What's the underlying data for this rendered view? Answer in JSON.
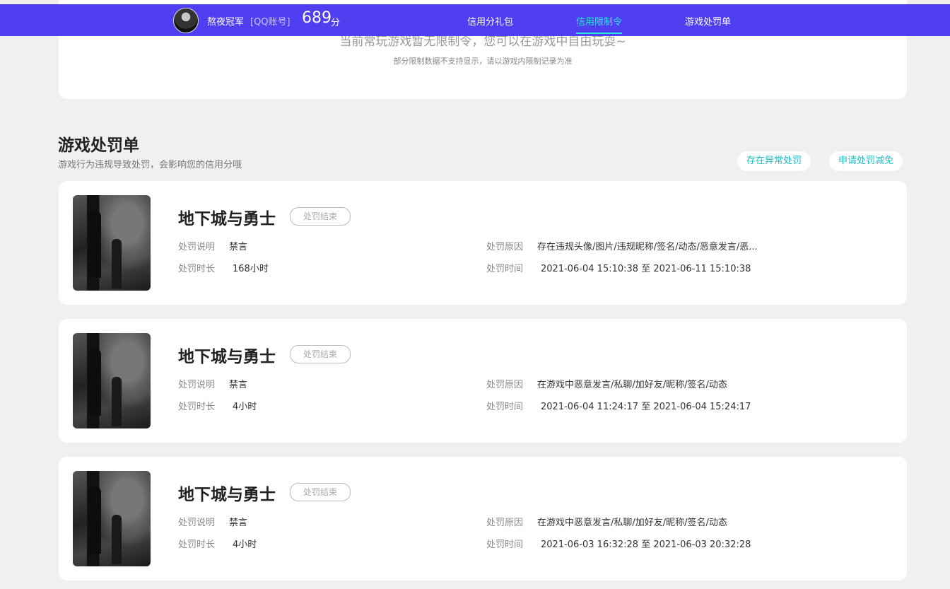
{
  "header": {
    "nickname": "熬夜冠军",
    "account_type": "[QQ账号]",
    "score": "689",
    "score_unit": "分",
    "nav": {
      "gift": "信用分礼包",
      "limit": "信用限制令",
      "punish": "游戏处罚单"
    },
    "active_tab": "信用限制令",
    "accent_color": "#4f3ff0",
    "active_color": "#2ee6e0"
  },
  "limit_card": {
    "message": "当前常玩游戏暂无限制令，您可以在游戏中自由玩耍~",
    "note": "部分限制数据不支持显示，请以游戏内限制记录为准"
  },
  "punish_section": {
    "title": "游戏处罚单",
    "subtitle": "游戏行为违规导致处罚，会影响您的信用分哦",
    "abnormal_button": "存在异常处罚",
    "reduce_button": "申请处罚减免"
  },
  "labels": {
    "desc": "处罚说明",
    "duration": "处罚时长",
    "reason": "处罚原因",
    "time": "处罚时间"
  },
  "records": [
    {
      "game": "地下城与勇士",
      "status": "处罚结束",
      "desc": "禁言",
      "duration": "168小时",
      "reason": "存在违规头像/图片/违规昵称/签名/动态/恶意发言/恶...",
      "time": "2021-06-04 15:10:38 至 2021-06-11 15:10:38"
    },
    {
      "game": "地下城与勇士",
      "status": "处罚结束",
      "desc": "禁言",
      "duration": "4小时",
      "reason": "在游戏中恶意发言/私聊/加好友/昵称/签名/动态",
      "time": "2021-06-04 11:24:17 至 2021-06-04 15:24:17"
    },
    {
      "game": "地下城与勇士",
      "status": "处罚结束",
      "desc": "禁言",
      "duration": "4小时",
      "reason": "在游戏中恶意发言/私聊/加好友/昵称/签名/动态",
      "time": "2021-06-03 16:32:28 至 2021-06-03 20:32:28"
    }
  ]
}
